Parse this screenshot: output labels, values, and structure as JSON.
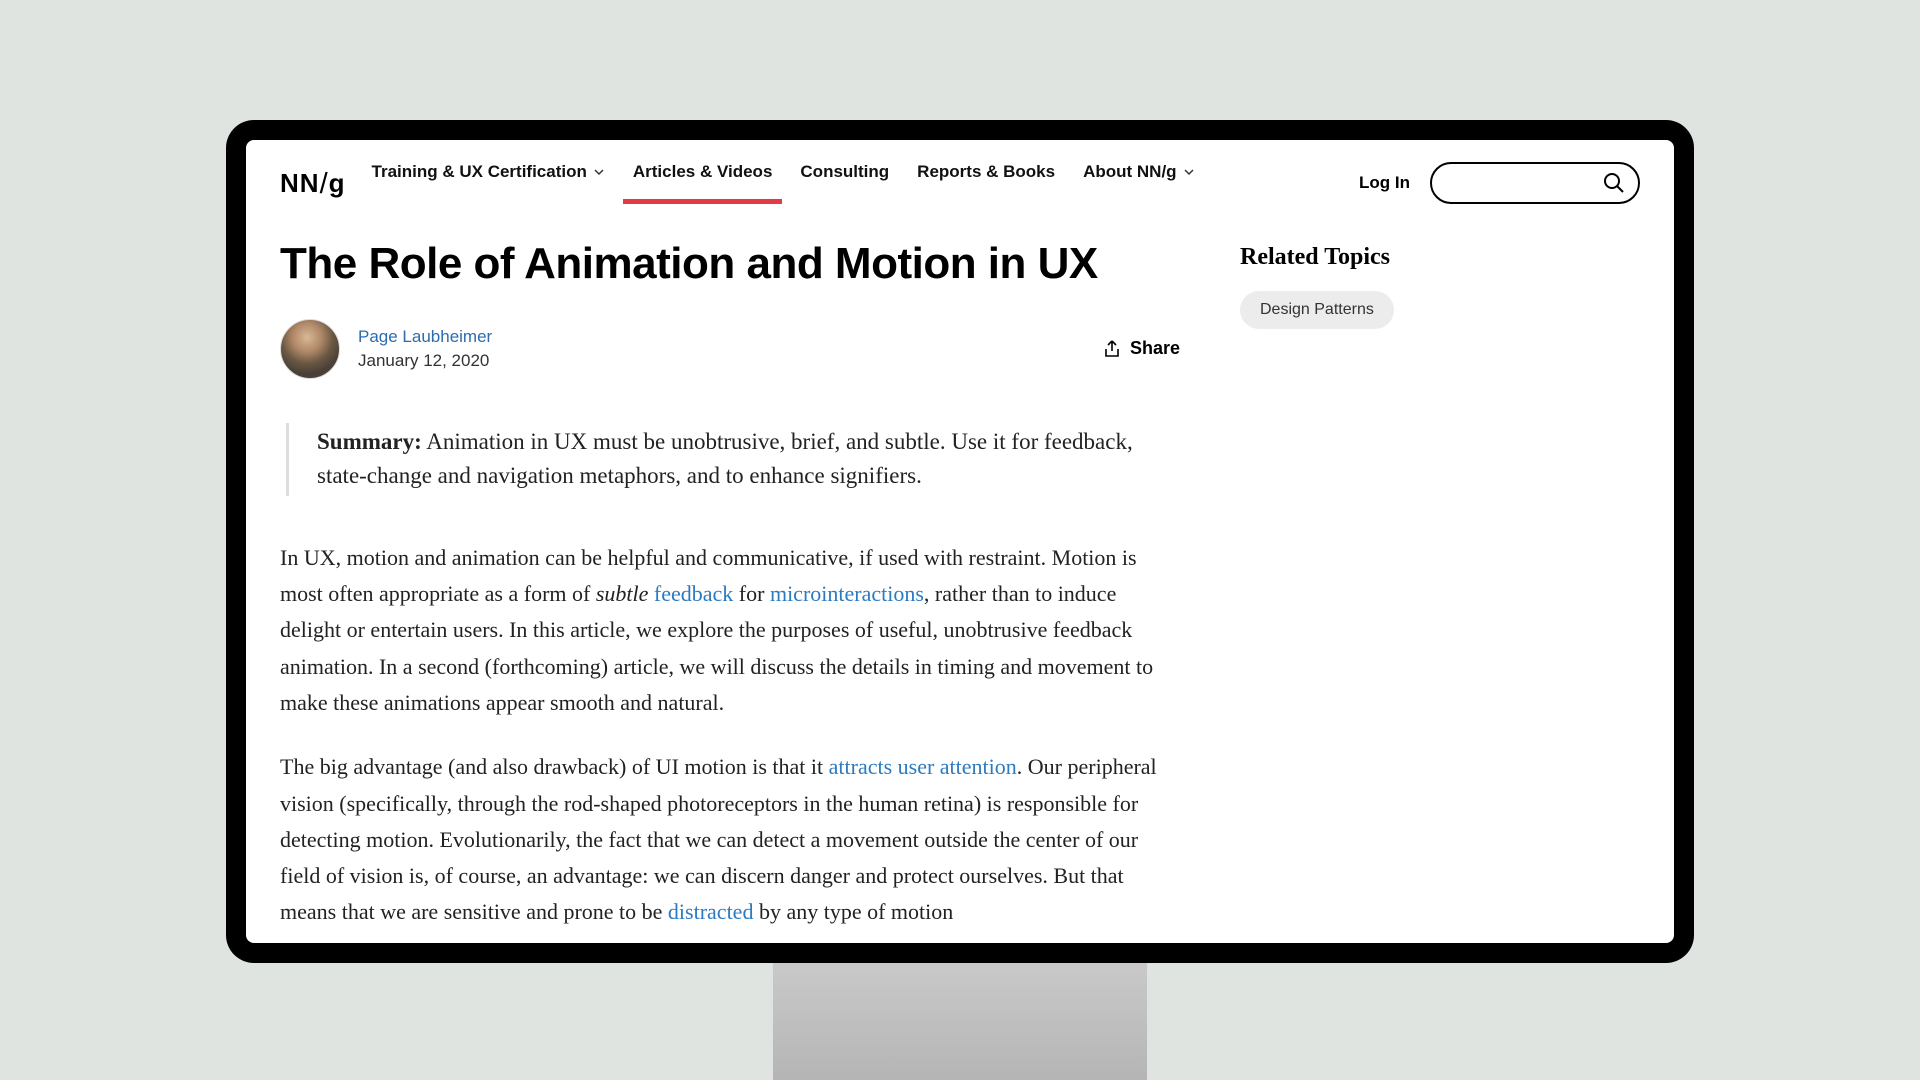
{
  "logo": {
    "text1": "NN",
    "text2": "g"
  },
  "nav": {
    "items": [
      {
        "label": "Training & UX Certification",
        "dropdown": true,
        "active": false
      },
      {
        "label": "Articles & Videos",
        "dropdown": false,
        "active": true
      },
      {
        "label": "Consulting",
        "dropdown": false,
        "active": false
      },
      {
        "label": "Reports & Books",
        "dropdown": false,
        "active": false
      },
      {
        "label": "About NN/g",
        "dropdown": true,
        "active": false
      }
    ],
    "login": "Log In"
  },
  "article": {
    "title": "The Role of Animation and Motion in UX",
    "author": "Page Laubheimer",
    "date": "January 12, 2020",
    "share": "Share",
    "summary_label": "Summary:",
    "summary_text": "  Animation in UX must be unobtrusive, brief, and subtle. Use it for feedback, state-change and navigation metaphors, and to enhance signifiers.",
    "para1": {
      "t1": "In UX, motion and animation can be helpful and communicative, if used with restraint. Motion is most often appropriate as a form of ",
      "em": "subtle",
      "t2": " ",
      "link1": "feedback",
      "t3": " for ",
      "link2": "microinteractions",
      "t4": ", rather than to induce delight or entertain users. In this article, we explore the purposes of useful, unobtrusive feedback animation. In a second (forthcoming) article, we will discuss the details in timing and movement to make these animations appear smooth and natural."
    },
    "para2": {
      "t1": "The big advantage (and also drawback) of UI motion is that it ",
      "link1": "attracts user attention",
      "t2": ". Our peripheral vision (specifically, through the rod-shaped photoreceptors in the human retina) is responsible for detecting motion.  Evolutionarily, the fact that we can detect a movement outside the center of our field of vision is, of course, an advantage: we can discern danger and protect ourselves. But that means that we are sensitive and prone to be ",
      "link2": "distracted",
      "t3": " by any type of motion"
    }
  },
  "sidebar": {
    "title": "Related Topics",
    "topics": [
      "Design Patterns"
    ]
  }
}
